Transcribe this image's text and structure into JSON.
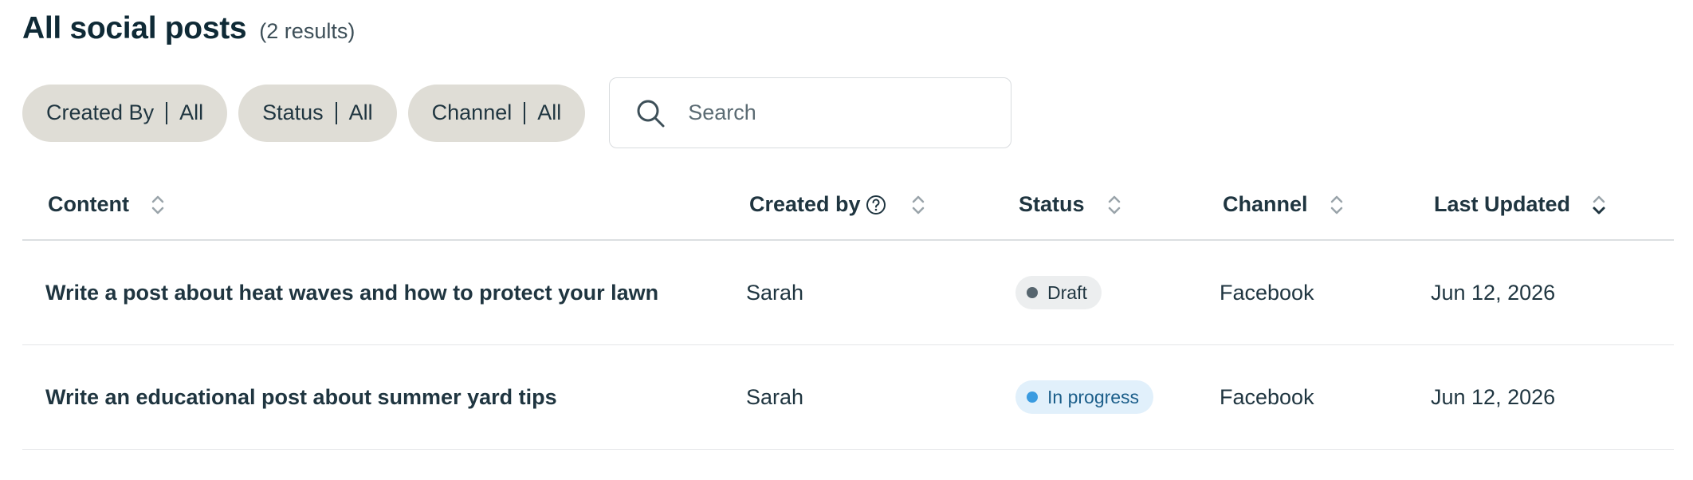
{
  "header": {
    "title": "All social posts",
    "count": "(2 results)"
  },
  "filters": [
    {
      "label": "Created By",
      "value": "All"
    },
    {
      "label": "Status",
      "value": "All"
    },
    {
      "label": "Channel",
      "value": "All"
    }
  ],
  "search": {
    "placeholder": "Search",
    "value": ""
  },
  "table": {
    "columns": [
      "Content",
      "Created by",
      "Status",
      "Channel",
      "Last Updated"
    ],
    "rows": [
      {
        "content": "Write a post about heat waves and how to protect your lawn",
        "created_by": "Sarah",
        "status": "Draft",
        "channel": "Facebook",
        "last_updated": "Jun 12, 2026"
      },
      {
        "content": "Write an educational post about summer yard tips",
        "created_by": "Sarah",
        "status": "In progress",
        "channel": "Facebook",
        "last_updated": "Jun 12, 2026"
      }
    ]
  },
  "colors": {
    "chip_bg": "#dfddd6",
    "text": "#1f3540",
    "draft_dot": "#56656e",
    "progress_dot": "#3a9be0",
    "progress_bg": "#e1f0fb"
  }
}
